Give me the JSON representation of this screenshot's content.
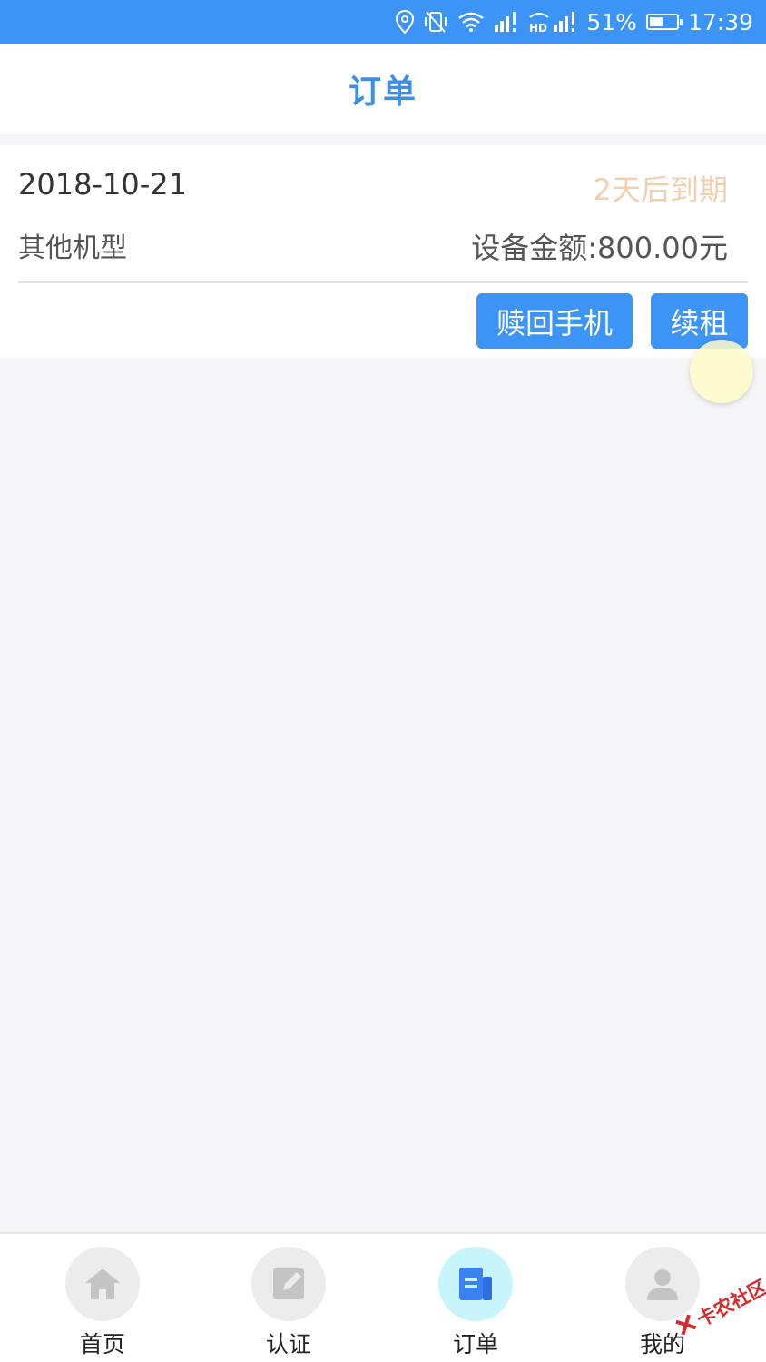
{
  "status_bar": {
    "battery_percent": "51%",
    "battery_level": 0.51,
    "time": "17:39",
    "icons": [
      "location-icon",
      "vibrate-off-icon",
      "wifi-icon",
      "signal-icon",
      "hd-signal-icon",
      "battery-icon"
    ]
  },
  "header": {
    "title": "订单"
  },
  "order": {
    "date": "2018-10-21",
    "status": "2天后到期",
    "model": "其他机型",
    "amount": "设备金额:800.00元",
    "buttons": {
      "redeem": "赎回手机",
      "renew": "续租"
    }
  },
  "bottom_nav": {
    "items": [
      {
        "label": "首页",
        "icon": "home-icon"
      },
      {
        "label": "认证",
        "icon": "edit-icon"
      },
      {
        "label": "订单",
        "icon": "order-icon",
        "active": true
      },
      {
        "label": "我的",
        "icon": "user-icon"
      }
    ]
  },
  "watermark": {
    "text": "卡农社区"
  },
  "colors": {
    "primary": "#3b94f6",
    "title_blue": "#3b8fe8",
    "status_orange": "#f4cfae",
    "background": "#f5f5f7",
    "active_nav_bg": "#c8f4fb"
  }
}
